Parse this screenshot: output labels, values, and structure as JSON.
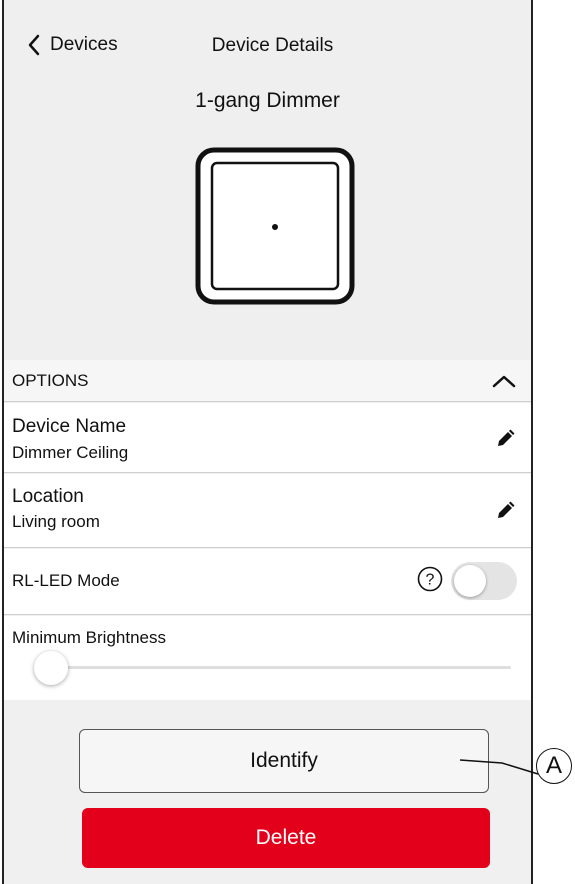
{
  "header": {
    "back_label": "Devices",
    "title": "Device Details",
    "device_type": "1-gang Dimmer"
  },
  "options": {
    "label": "OPTIONS",
    "device_name": {
      "title": "Device Name",
      "value": "Dimmer Ceiling"
    },
    "location": {
      "title": "Location",
      "value": "Living room"
    },
    "rl_led_mode": {
      "title": "RL-LED Mode",
      "enabled": false
    },
    "minimum_brightness": {
      "title": "Minimum Brightness",
      "value": 0
    }
  },
  "actions": {
    "identify_label": "Identify",
    "delete_label": "Delete"
  },
  "callout": {
    "label": "A"
  },
  "colors": {
    "delete": "#e2001a",
    "background": "#efefef"
  },
  "icons": [
    "chevron-left-icon",
    "device-dimmer-icon",
    "chevron-up-icon",
    "pencil-icon",
    "help-icon"
  ]
}
